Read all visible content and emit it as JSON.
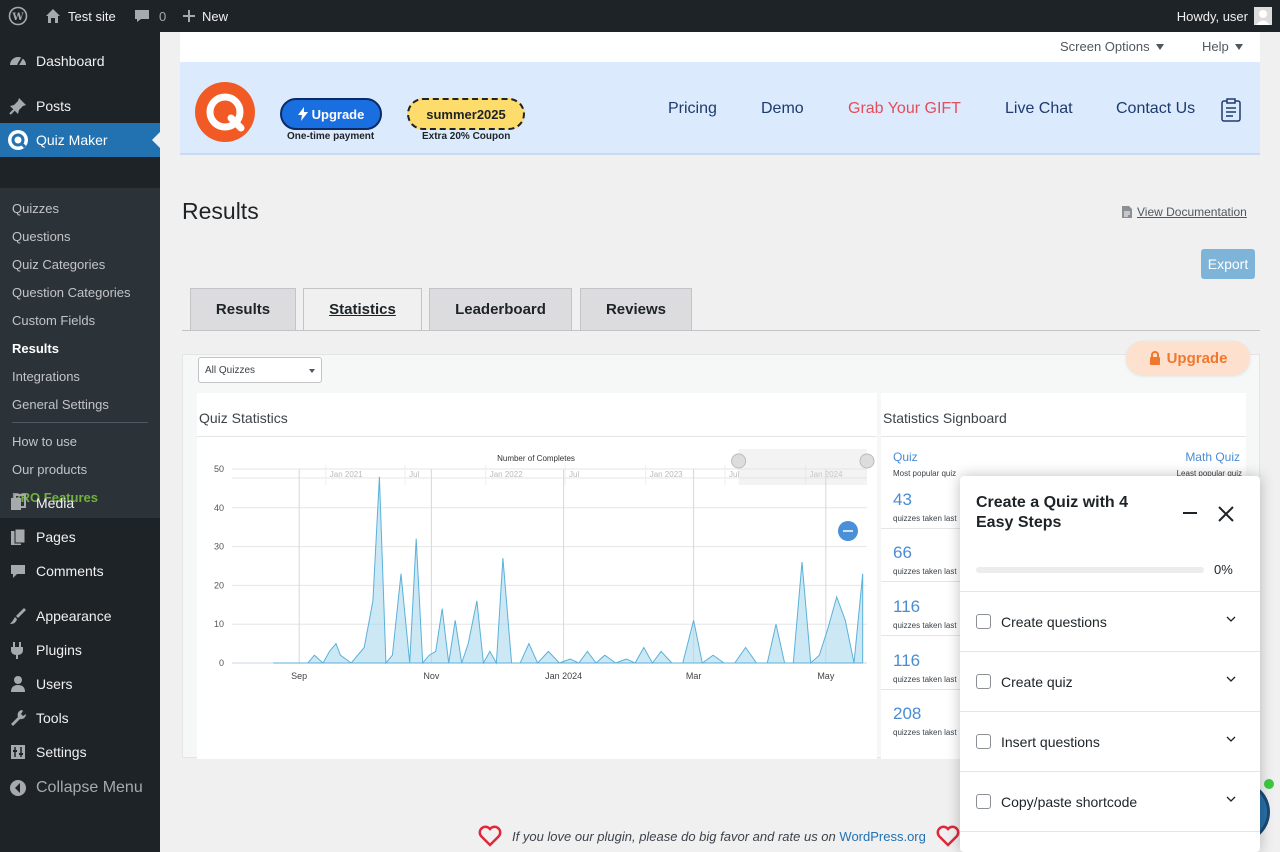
{
  "adminbar": {
    "site": "Test site",
    "comments": "0",
    "new": "New",
    "greeting": "Howdy, user"
  },
  "menu": {
    "items": [
      {
        "label": "Dashboard",
        "icon": "dashboard-icon"
      },
      {
        "label": "Posts",
        "icon": "pin-icon"
      },
      {
        "label": "Quiz Maker",
        "icon": "quiz-maker-icon"
      },
      {
        "label": "Media",
        "icon": "media-icon"
      },
      {
        "label": "Pages",
        "icon": "pages-icon"
      },
      {
        "label": "Comments",
        "icon": "comments-icon"
      },
      {
        "label": "Appearance",
        "icon": "brush-icon"
      },
      {
        "label": "Plugins",
        "icon": "plugin-icon"
      },
      {
        "label": "Users",
        "icon": "users-icon"
      },
      {
        "label": "Tools",
        "icon": "wrench-icon"
      },
      {
        "label": "Settings",
        "icon": "settings-icon"
      },
      {
        "label": "Collapse Menu",
        "icon": "collapse-icon"
      }
    ],
    "sub": [
      "Quizzes",
      "Questions",
      "Quiz Categories",
      "Question Categories",
      "Custom Fields",
      "Results",
      "Integrations",
      "General Settings",
      "How to use",
      "Our products",
      "PRO Features"
    ]
  },
  "top": {
    "screen_options": "Screen Options",
    "help": "Help"
  },
  "banner": {
    "upgrade": "Upgrade",
    "one_time": "One-time payment",
    "coupon": "summer2025",
    "coupon_sub": "Extra 20% Coupon",
    "nav": [
      "Pricing",
      "Demo",
      "Grab Your GIFT",
      "Live Chat",
      "Contact Us"
    ]
  },
  "page": {
    "title": "Results",
    "doc": "View Documentation",
    "export": "Export"
  },
  "tabs": [
    "Results",
    "Statistics",
    "Leaderboard",
    "Reviews"
  ],
  "panel": {
    "upgrade": "Upgrade",
    "select": "All Quizzes",
    "quiz_stats": "Quiz Statistics",
    "signboard": "Statistics Signboard"
  },
  "signboard": {
    "left_name": "Quiz",
    "left_sub": "Most popular quiz",
    "right_name": "Math Quiz",
    "right_sub": "Least popular quiz",
    "rows": [
      {
        "value": "43",
        "sub": "quizzes taken last"
      },
      {
        "value": "66",
        "sub": "quizzes taken last"
      },
      {
        "value": "116",
        "sub": "quizzes taken last"
      },
      {
        "value": "116",
        "sub": "quizzes taken last"
      },
      {
        "value": "208",
        "sub": "quizzes taken last"
      }
    ]
  },
  "widget": {
    "title": "Create a Quiz with 4 Easy Steps",
    "progress": "0%",
    "progress_value": 0,
    "steps": [
      "Create questions",
      "Create quiz",
      "Insert questions",
      "Copy/paste shortcode"
    ]
  },
  "footer": {
    "text": "If you love our plugin, please do big favor and rate us on",
    "link": "WordPress.org"
  },
  "chart_data": {
    "type": "area",
    "title": "Number of Completes",
    "ylim": [
      0,
      50
    ],
    "yticks": [
      0,
      10,
      20,
      30,
      40,
      50
    ],
    "xticks": [
      "Sep",
      "Nov",
      "Jan 2024",
      "Mar",
      "May"
    ],
    "navigator_ticks": [
      "Jan 2021",
      "Jul",
      "Jan 2022",
      "Jul",
      "Jan 2023",
      "Jul",
      "Jan 2024"
    ],
    "x": [
      "2023-08-20",
      "2023-08-28",
      "2023-09-05",
      "2023-09-08",
      "2023-09-12",
      "2023-09-15",
      "2023-09-18",
      "2023-09-20",
      "2023-09-25",
      "2023-10-01",
      "2023-10-05",
      "2023-10-08",
      "2023-10-11",
      "2023-10-14",
      "2023-10-18",
      "2023-10-22",
      "2023-10-25",
      "2023-10-28",
      "2023-10-31",
      "2023-11-03",
      "2023-11-06",
      "2023-11-09",
      "2023-11-12",
      "2023-11-15",
      "2023-11-18",
      "2023-11-22",
      "2023-11-25",
      "2023-11-28",
      "2023-12-01",
      "2023-12-04",
      "2023-12-08",
      "2023-12-12",
      "2023-12-16",
      "2023-12-20",
      "2023-12-25",
      "2023-12-30",
      "2024-01-04",
      "2024-01-08",
      "2024-01-12",
      "2024-01-16",
      "2024-01-20",
      "2024-01-25",
      "2024-01-30",
      "2024-02-03",
      "2024-02-07",
      "2024-02-11",
      "2024-02-15",
      "2024-02-20",
      "2024-02-25",
      "2024-03-01",
      "2024-03-05",
      "2024-03-10",
      "2024-03-15",
      "2024-03-20",
      "2024-03-25",
      "2024-03-30",
      "2024-04-04",
      "2024-04-08",
      "2024-04-12",
      "2024-04-16",
      "2024-04-20",
      "2024-04-24",
      "2024-04-28",
      "2024-05-02",
      "2024-05-06",
      "2024-05-10",
      "2024-05-14",
      "2024-05-18"
    ],
    "values": [
      0,
      0,
      0,
      2,
      0,
      3,
      5,
      2,
      0,
      4,
      16,
      48,
      0,
      2,
      23,
      0,
      32,
      0,
      2,
      3,
      14,
      0,
      11,
      0,
      5,
      16,
      0,
      3,
      0,
      27,
      0,
      0,
      5,
      0,
      3,
      0,
      1,
      0,
      3,
      0,
      2,
      0,
      1,
      0,
      4,
      0,
      3,
      0,
      0,
      11,
      0,
      2,
      0,
      0,
      4,
      0,
      0,
      10,
      0,
      0,
      26,
      0,
      2,
      9,
      17,
      11,
      0,
      23
    ]
  }
}
